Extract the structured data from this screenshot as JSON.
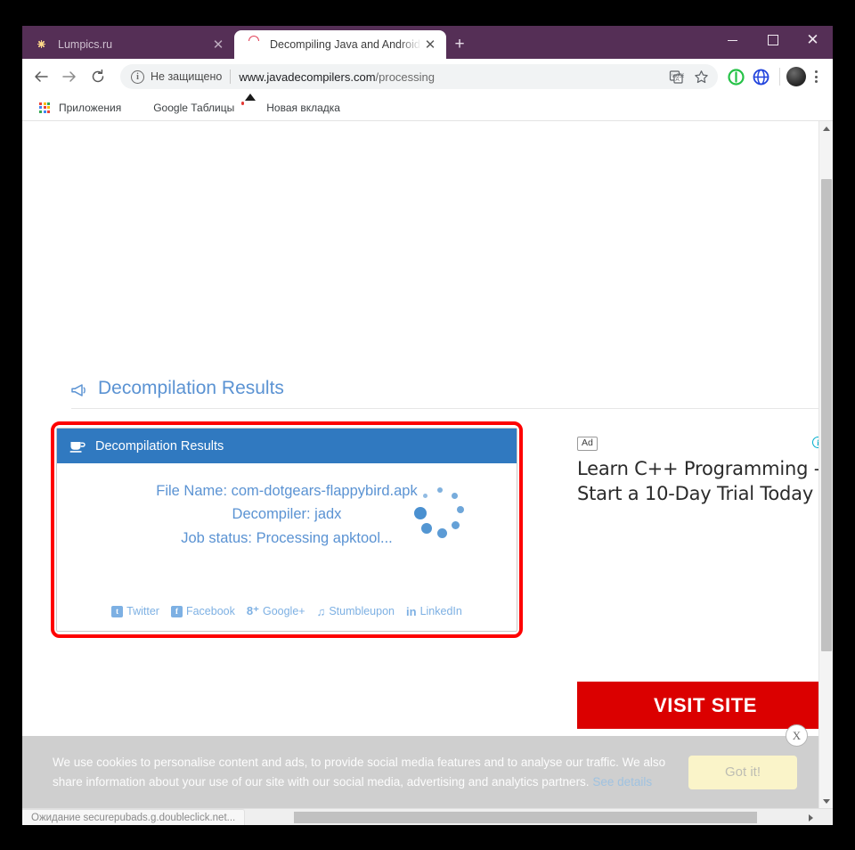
{
  "browser": {
    "tabs": [
      {
        "title": "Lumpics.ru",
        "favicon": "orange-fruit-icon",
        "active": false,
        "close_label": "✕"
      },
      {
        "title": "Decompiling Java and Android a",
        "favicon": "red-server-icon",
        "active": true,
        "close_label": "✕"
      }
    ],
    "new_tab_label": "+",
    "window_controls": {
      "minimize": "minimize-icon",
      "maximize": "maximize-icon",
      "close": "✕"
    },
    "toolbar": {
      "back": "back-arrow-icon",
      "forward": "forward-arrow-icon",
      "reload": "reload-icon",
      "security_label": "Не защищено",
      "url_bold": "www.javadecompilers.com",
      "url_dim": "/processing",
      "translate_icon": "translate-icon",
      "bookmark_icon": "star-icon",
      "ext1_icon": "green-shield-extension-icon",
      "ext2_icon": "blue-globe-extension-icon",
      "avatar_icon": "profile-avatar",
      "menu_icon": "kebab-menu-icon"
    },
    "bookmarks": [
      {
        "label": "Приложения",
        "icon": "apps-grid-icon"
      },
      {
        "label": "Google Таблицы",
        "icon": "google-sheets-icon"
      },
      {
        "label": "Новая вкладка",
        "icon": "picture-icon"
      }
    ],
    "status_text": "Ожидание securepubads.g.doubleclick.net..."
  },
  "page": {
    "heading": "Decompilation Results",
    "heading_icon": "bullhorn-icon",
    "panel": {
      "header_title": "Decompilation Results",
      "header_icon": "java-coffee-cup-icon",
      "lines": [
        "File Name: com-dotgears-flappybird.apk",
        "Decompiler: jadx",
        "Job status: Processing apktool..."
      ],
      "spinner_icon": "loading-spinner-icon",
      "share_links": [
        {
          "label": "Twitter",
          "icon": "twitter-icon",
          "glyph": "t"
        },
        {
          "label": "Facebook",
          "icon": "facebook-icon",
          "glyph": "f"
        },
        {
          "label": "Google+",
          "icon": "google-plus-icon",
          "glyph": "8⁺"
        },
        {
          "label": "Stumbleupon",
          "icon": "stumbleupon-icon",
          "glyph": "♫"
        },
        {
          "label": "LinkedIn",
          "icon": "linkedin-icon",
          "glyph": "in"
        }
      ]
    },
    "ad": {
      "badge": "Ad",
      "info_icon": "ad-info-icon",
      "headline": "Learn C++ Programming - Start a 10-Day Trial Today",
      "cta_label": "VISIT SITE"
    },
    "cookie": {
      "text": "We use cookies to personalise content and ads, to provide social media features and to analyse our traffic. We also share information about your use of our site with our social media, advertising and analytics partners. ",
      "link_label": "See details",
      "button_label": "Got it!",
      "close_label": "X"
    }
  },
  "colors": {
    "chrome_frame": "#552f56",
    "panel_header": "#3079c0",
    "accent_blue": "#5b93d3",
    "highlight_red": "#fe0000",
    "ad_red": "#db0000"
  }
}
